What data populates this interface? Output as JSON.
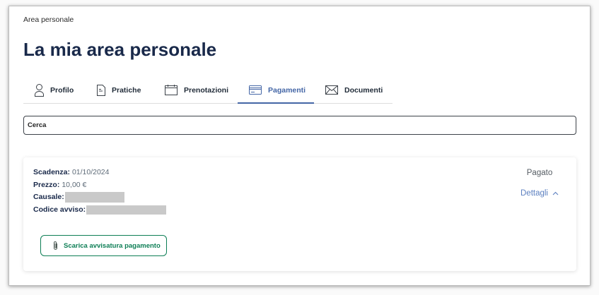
{
  "breadcrumb": "Area personale",
  "page_title": "La mia area personale",
  "tabs": [
    {
      "label": "Profilo",
      "icon": "user-icon",
      "active": false
    },
    {
      "label": "Pratiche",
      "icon": "document-icon",
      "active": false
    },
    {
      "label": "Prenotazioni",
      "icon": "calendar-icon",
      "active": false
    },
    {
      "label": "Pagamenti",
      "icon": "credit-card-icon",
      "active": true
    },
    {
      "label": "Documenti",
      "icon": "envelope-icon",
      "active": false
    }
  ],
  "search": {
    "placeholder": "Cerca"
  },
  "payment": {
    "fields": {
      "scadenza": {
        "label": "Scadenza:",
        "value": "01/10/2024"
      },
      "prezzo": {
        "label": "Prezzo:",
        "value": "10,00 €"
      },
      "causale": {
        "label": "Causale:"
      },
      "codice_avviso": {
        "label": "Codice avviso:"
      }
    },
    "status": "Pagato",
    "details_toggle": {
      "label": "Dettagli",
      "icon": "chevron-up-icon",
      "expanded": true
    },
    "download_button": {
      "label": "Scarica avvisatura pagamento",
      "icon": "paperclip-icon"
    }
  },
  "colors": {
    "title": "#19294a",
    "accent": "#4466a6",
    "success": "#0d7e55",
    "muted": "#5e6b78"
  }
}
